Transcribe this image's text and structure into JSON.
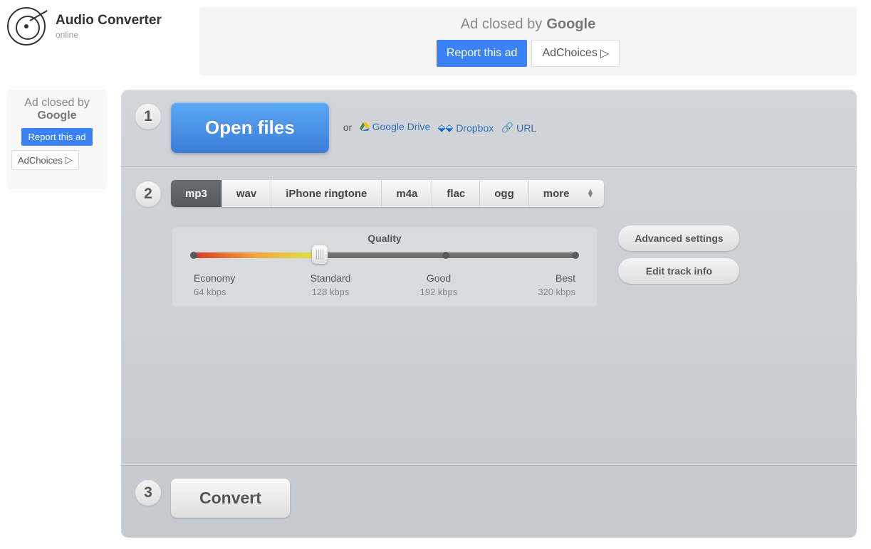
{
  "header": {
    "title": "Audio Converter",
    "subtitle": "online"
  },
  "ads": {
    "closed_by": "Ad closed by",
    "google": "Google",
    "report": "Report this ad",
    "adchoices": "AdChoices"
  },
  "step1": {
    "open": "Open files",
    "or": "or",
    "gdrive": "Google Drive",
    "dropbox": "Dropbox",
    "url": "URL"
  },
  "formats": [
    "mp3",
    "wav",
    "iPhone ringtone",
    "m4a",
    "flac",
    "ogg",
    "more"
  ],
  "quality": {
    "title": "Quality",
    "levels": [
      {
        "name": "Economy",
        "rate": "64 kbps"
      },
      {
        "name": "Standard",
        "rate": "128 kbps"
      },
      {
        "name": "Good",
        "rate": "192 kbps"
      },
      {
        "name": "Best",
        "rate": "320 kbps"
      }
    ]
  },
  "buttons": {
    "advanced": "Advanced settings",
    "trackinfo": "Edit track info",
    "convert": "Convert"
  }
}
